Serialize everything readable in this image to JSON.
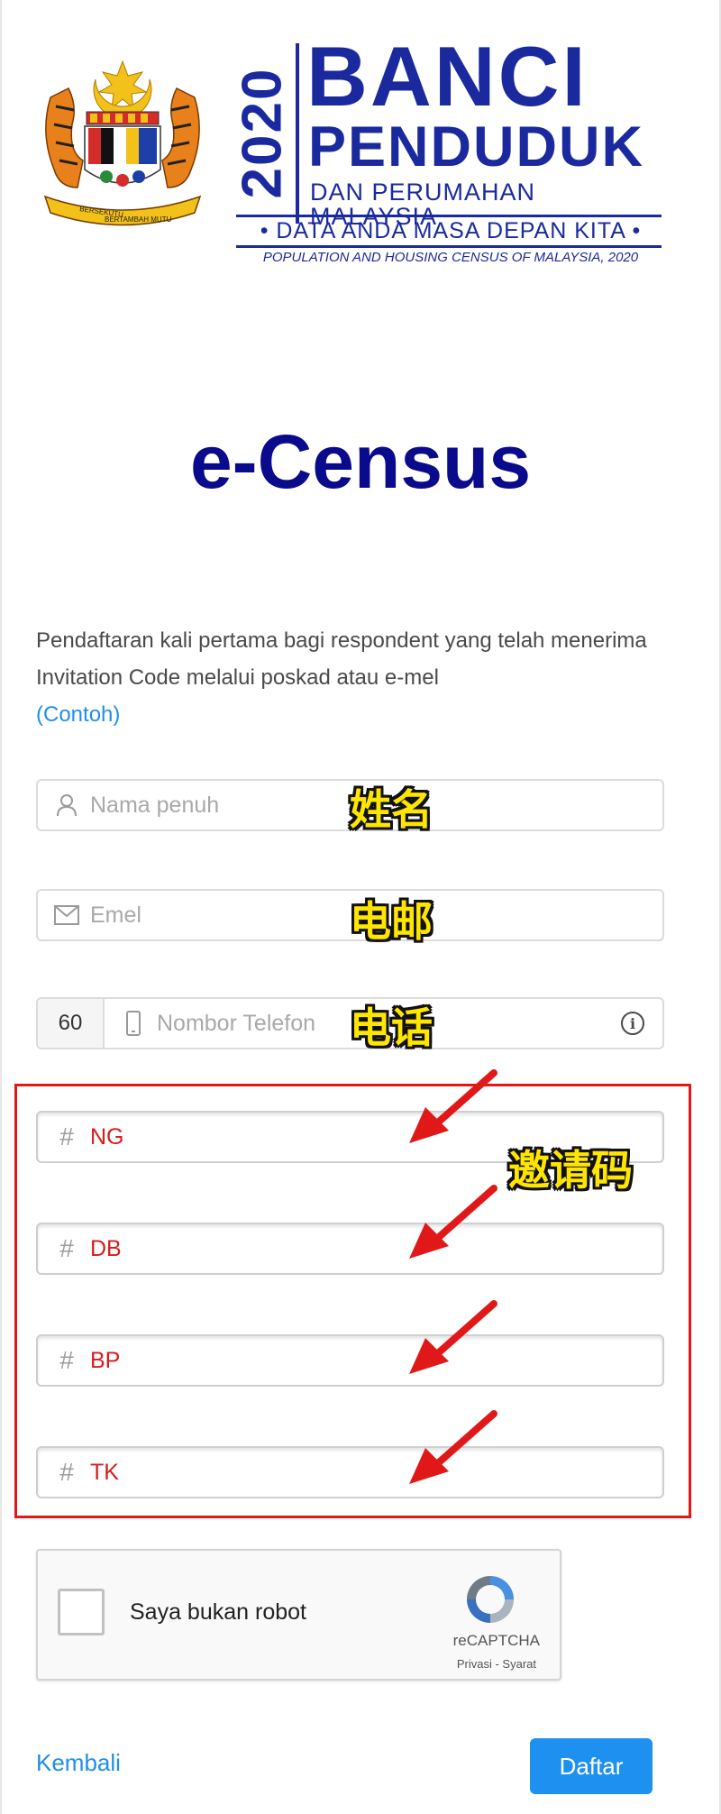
{
  "header": {
    "census_year": "2020",
    "title_line1": "BANCI",
    "title_line2": "PENDUDUK",
    "title_line3": "DAN PERUMAHAN MALAYSIA",
    "tagline": "DATA ANDA MASA DEPAN KITA",
    "english_title": "POPULATION AND HOUSING CENSUS OF MALAYSIA, 2020",
    "crest_motto_left": "BERSEKUTU",
    "crest_motto_right": "BERTAMBAH MUTU"
  },
  "page_title": "e-Census",
  "intro": {
    "text": "Pendaftaran kali pertama bagi respondent yang telah menerima Invitation Code melalui poskad atau e-mel",
    "example_link": "(Contoh)"
  },
  "form": {
    "full_name": {
      "icon": "user-icon",
      "placeholder": "Nama penuh",
      "annotation": "姓名"
    },
    "email": {
      "icon": "mail-icon",
      "placeholder": "Emel",
      "annotation": "电邮"
    },
    "phone": {
      "icon": "phone-icon",
      "prefix": "60",
      "placeholder": "Nombor Telefon",
      "annotation": "电话",
      "info_icon": "info-icon"
    },
    "invitation_codes": {
      "annotation": "邀请码",
      "items": [
        {
          "icon": "hash-icon",
          "value": "NG"
        },
        {
          "icon": "hash-icon",
          "value": "DB"
        },
        {
          "icon": "hash-icon",
          "value": "BP"
        },
        {
          "icon": "hash-icon",
          "value": "TK"
        }
      ]
    }
  },
  "captcha": {
    "label": "Saya bukan robot",
    "brand": "reCAPTCHA",
    "privacy": "Privasi",
    "terms": "Syarat",
    "separator": " - "
  },
  "footer": {
    "back_label": "Kembali",
    "submit_label": "Daftar"
  },
  "colors": {
    "brand_blue": "#1a2a9e",
    "title_navy": "#0a0a8c",
    "link_blue": "#1f8fe6",
    "button_blue": "#1e90ef",
    "highlight_red": "#e11818",
    "annotation_yellow": "#ffe600"
  }
}
